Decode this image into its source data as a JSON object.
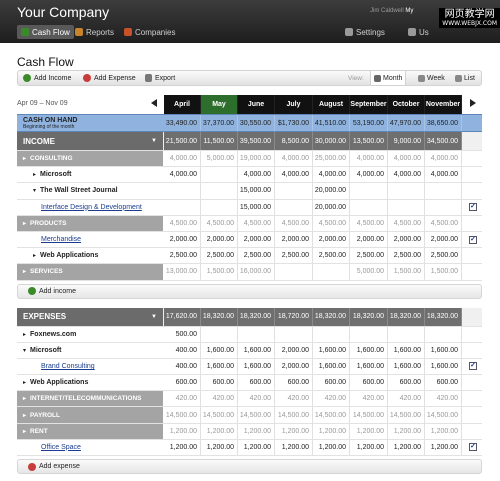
{
  "header": {
    "company": "Your Company",
    "user": "Jim Caldwell",
    "user_link": "My",
    "nav": [
      {
        "label": "Cash Flow",
        "icon": "dollar-icon"
      },
      {
        "label": "Reports",
        "icon": "chart-icon"
      },
      {
        "label": "Companies",
        "icon": "briefcase-icon"
      },
      {
        "label": "Settings",
        "icon": "wrench-icon"
      },
      {
        "label": "Us",
        "icon": "user-icon"
      }
    ],
    "watermark": "网页教学网",
    "watermark_sub": "WWW.WEBJX.COM"
  },
  "page": {
    "title": "Cash Flow"
  },
  "toolbar": {
    "add_income": "Add Income",
    "add_expense": "Add Expense",
    "export": "Export",
    "view_label": "View:",
    "views": [
      "Month",
      "Week",
      "List"
    ],
    "active_view": "Month"
  },
  "date_range": "Apr 09 – Nov 09",
  "months": [
    "April",
    "May",
    "June",
    "July",
    "August",
    "September",
    "October",
    "November"
  ],
  "current_month": "May",
  "cash_on_hand": {
    "label": "CASH ON HAND",
    "sub": "Beginning of the month",
    "values": [
      "33,490.00",
      "37,370.00",
      "30,550.00",
      "$1,730.00",
      "41,510.00",
      "53,190.00",
      "47,970.00",
      "38,650.00"
    ]
  },
  "rows": [
    {
      "type": "section",
      "label": "INCOME",
      "values": [
        "21,500.00",
        "11,500.00",
        "39,500.00",
        "8,500.00",
        "30,000.00",
        "13,500.00",
        "9,000.00",
        "34,500.00"
      ]
    },
    {
      "type": "category",
      "label": "CONSULTING",
      "values": [
        "4,000.00",
        "5,000.00",
        "19,000.00",
        "4,000.00",
        "25,000.00",
        "4,000.00",
        "4,000.00",
        "4,000.00"
      ]
    },
    {
      "type": "item",
      "label": "Microsoft",
      "values": [
        "4,000.00",
        "",
        "4,000.00",
        "4,000.00",
        "4,000.00",
        "4,000.00",
        "4,000.00",
        "4,000.00"
      ]
    },
    {
      "type": "item-open",
      "label": "The Wall Street Journal",
      "values": [
        "",
        "",
        "15,000.00",
        "",
        "20,000.00",
        "",
        "",
        ""
      ]
    },
    {
      "type": "link",
      "label": "Interface Design & Development",
      "values": [
        "",
        "",
        "15,000.00",
        "",
        "20,000.00",
        "",
        "",
        ""
      ],
      "checked": true
    },
    {
      "type": "category",
      "label": "PRODUCTS",
      "values": [
        "4,500.00",
        "4,500.00",
        "4,500.00",
        "4,500.00",
        "4,500.00",
        "4,500.00",
        "4,500.00",
        "4,500.00"
      ]
    },
    {
      "type": "link",
      "label": "Merchandise",
      "values": [
        "2,000.00",
        "2,000.00",
        "2,000.00",
        "2,000.00",
        "2,000.00",
        "2,000.00",
        "2,000.00",
        "2,000.00"
      ],
      "checked": true
    },
    {
      "type": "item",
      "label": "Web Applications",
      "values": [
        "2,500.00",
        "2,500.00",
        "2,500.00",
        "2,500.00",
        "2,500.00",
        "2,500.00",
        "2,500.00",
        "2,500.00"
      ]
    },
    {
      "type": "category",
      "label": "SERVICES",
      "values": [
        "13,000.00",
        "1,500.00",
        "16,000.00",
        "",
        "",
        "5,000.00",
        "1,500.00",
        "1,500.00"
      ]
    },
    {
      "type": "add",
      "label": "Add income"
    },
    {
      "type": "section",
      "label": "EXPENSES",
      "values": [
        "17,620.00",
        "18,320.00",
        "18,320.00",
        "18,720.00",
        "18,320.00",
        "18,320.00",
        "18,320.00",
        "18,320.00"
      ]
    },
    {
      "type": "item",
      "label": "Foxnews.com",
      "values": [
        "500.00",
        "",
        "",
        "",
        "",
        "",
        "",
        ""
      ]
    },
    {
      "type": "item-open",
      "label": "Microsoft",
      "values": [
        "400.00",
        "1,600.00",
        "1,600.00",
        "2,000.00",
        "1,600.00",
        "1,600.00",
        "1,600.00",
        "1,600.00"
      ]
    },
    {
      "type": "link",
      "label": "Brand Consulting",
      "values": [
        "400.00",
        "1,600.00",
        "1,600.00",
        "2,000.00",
        "1,600.00",
        "1,600.00",
        "1,600.00",
        "1,600.00"
      ],
      "checked": true
    },
    {
      "type": "item",
      "label": "Web Applications",
      "values": [
        "600.00",
        "600.00",
        "600.00",
        "600.00",
        "600.00",
        "600.00",
        "600.00",
        "600.00"
      ]
    },
    {
      "type": "category",
      "label": "INTERNET/TELECOMMUNICATIONS",
      "values": [
        "420.00",
        "420.00",
        "420.00",
        "420.00",
        "420.00",
        "420.00",
        "420.00",
        "420.00"
      ]
    },
    {
      "type": "category",
      "label": "PAYROLL",
      "values": [
        "14,500.00",
        "14,500.00",
        "14,500.00",
        "14,500.00",
        "14,500.00",
        "14,500.00",
        "14,500.00",
        "14,500.00"
      ]
    },
    {
      "type": "category",
      "label": "RENT",
      "values": [
        "1,200.00",
        "1,200.00",
        "1,200.00",
        "1,200.00",
        "1,200.00",
        "1,200.00",
        "1,200.00",
        "1,200.00"
      ]
    },
    {
      "type": "link",
      "label": "Office Space",
      "values": [
        "1,200.00",
        "1,200.00",
        "1,200.00",
        "1,200.00",
        "1,200.00",
        "1,200.00",
        "1,200.00",
        "1,200.00"
      ],
      "checked": true
    },
    {
      "type": "add",
      "label": "Add expense"
    }
  ],
  "colors": {
    "month_header": "#111111",
    "current_month": "#2d6e2d",
    "cash_on_hand": "#8fb3de",
    "section": "#6b6b6b",
    "category": "#a4a4a4",
    "add_income_dot": "#3a8a2a",
    "add_expense_dot": "#c83c3c"
  }
}
